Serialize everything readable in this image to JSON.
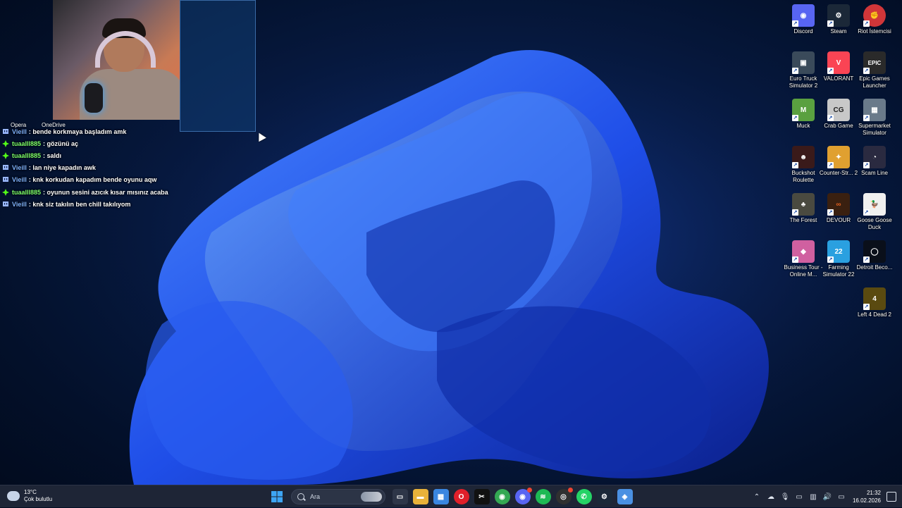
{
  "webcam": {
    "label": "webcam overlay"
  },
  "top_left_icons": [
    {
      "label": "Opera"
    },
    {
      "label": "OneDrive"
    }
  ],
  "chat": {
    "messages": [
      {
        "user": "Vieill",
        "text": ": bende korkmaya başladım amk",
        "user_color": "#7fb3ff",
        "icon": "twitch-badge-icon"
      },
      {
        "user": "tuaalll885",
        "text": ": gözünü aç",
        "user_color": "#7dff6a",
        "icon": "kick-badge-icon"
      },
      {
        "user": "tuaalll885",
        "text": ": saldı",
        "user_color": "#7dff6a",
        "icon": "kick-badge-icon"
      },
      {
        "user": "Vieill",
        "text": ": lan niye kapadın awk",
        "user_color": "#7fb3ff",
        "icon": "twitch-badge-icon"
      },
      {
        "user": "Vieill",
        "text": ": knk korkudan kapadım bende oyunu aqw",
        "user_color": "#7fb3ff",
        "icon": "twitch-badge-icon"
      },
      {
        "user": "tuaalll885",
        "text": ": oyunun sesini azıcık kısar mısınız acaba",
        "user_color": "#7dff6a",
        "icon": "kick-badge-icon"
      },
      {
        "user": "Vieill",
        "text": ": knk siz takılın ben chill takılıyom",
        "user_color": "#7fb3ff",
        "icon": "twitch-badge-icon"
      }
    ]
  },
  "desktop_icons": [
    {
      "label": "Discord",
      "icon": "discord-icon",
      "color": "#5865f2",
      "glyph": "◉"
    },
    {
      "label": "Steam",
      "icon": "steam-icon",
      "color": "#1b2838",
      "glyph": "⚙"
    },
    {
      "label": "Riot İstemcisi",
      "icon": "riot-icon",
      "color": "#d13639",
      "glyph": "✊"
    },
    {
      "label": "Euro Truck Simulator 2",
      "icon": "euro-truck-icon",
      "color": "#3a4a5a",
      "glyph": "▣"
    },
    {
      "label": "VALORANT",
      "icon": "valorant-icon",
      "color": "#fa4454",
      "glyph": "V"
    },
    {
      "label": "Epic Games Launcher",
      "icon": "epic-games-icon",
      "color": "#2a2a2a",
      "glyph": "EPIC"
    },
    {
      "label": "Muck",
      "icon": "muck-icon",
      "color": "#5aa040",
      "glyph": "M"
    },
    {
      "label": "Crab Game",
      "icon": "crab-game-icon",
      "color": "#c8c8c8",
      "glyph": "CG"
    },
    {
      "label": "Supermarket Simulator",
      "icon": "supermarket-icon",
      "color": "#6a7a8a",
      "glyph": "▦"
    },
    {
      "label": "Buckshot Roulette",
      "icon": "buckshot-icon",
      "color": "#3a1a1a",
      "glyph": "☻"
    },
    {
      "label": "Counter-Str... 2",
      "icon": "counter-strike-icon",
      "color": "#e0a030",
      "glyph": "✦"
    },
    {
      "label": "Scam Line",
      "icon": "scam-line-icon",
      "color": "#2a2a40",
      "glyph": "◔"
    },
    {
      "label": "The Forest",
      "icon": "the-forest-icon",
      "color": "#4a4a40",
      "glyph": "♣"
    },
    {
      "label": "DEVOUR",
      "icon": "devour-icon",
      "color": "#3a2010",
      "glyph": "∞"
    },
    {
      "label": "Goose Goose Duck",
      "icon": "goose-goose-duck-icon",
      "color": "#f0f0f0",
      "glyph": "🦆"
    },
    {
      "label": "Business Tour - Online M...",
      "icon": "business-tour-icon",
      "color": "#d060a0",
      "glyph": "◆"
    },
    {
      "label": "Farming Simulator 22",
      "icon": "farming-simulator-icon",
      "color": "#2aa0e0",
      "glyph": "22"
    },
    {
      "label": "Detroit Beco...",
      "icon": "detroit-icon",
      "color": "#0a0f1a",
      "glyph": "◯"
    },
    {
      "label": "Left 4 Dead 2",
      "icon": "left4dead-icon",
      "color": "#5a4a10",
      "glyph": "4"
    }
  ],
  "taskbar": {
    "weather": {
      "temp": "13°C",
      "condition": "Çok bulutlu"
    },
    "search_placeholder": "Ara",
    "apps": [
      {
        "icon": "task-view-icon",
        "color": "#2e3648",
        "glyph": "▭"
      },
      {
        "icon": "file-explorer-icon",
        "color": "#e8b23a",
        "glyph": "▬"
      },
      {
        "icon": "microsoft-store-icon",
        "color": "#3a86e0",
        "glyph": "▦"
      },
      {
        "icon": "opera-icon",
        "color": "#e0202a",
        "glyph": "O"
      },
      {
        "icon": "capcut-icon",
        "color": "#111111",
        "glyph": "✂"
      },
      {
        "icon": "chrome-icon",
        "color": "#34a853",
        "glyph": "◉"
      },
      {
        "icon": "discord-icon",
        "color": "#5865f2",
        "glyph": "◉"
      },
      {
        "icon": "spotify-icon",
        "color": "#1db954",
        "glyph": "≋"
      },
      {
        "icon": "obs-icon",
        "color": "#303030",
        "glyph": "◎"
      },
      {
        "icon": "whatsapp-icon",
        "color": "#25d366",
        "glyph": "✆"
      },
      {
        "icon": "steam-icon",
        "color": "#1b2838",
        "glyph": "⚙"
      },
      {
        "icon": "app-icon",
        "color": "#4a90e2",
        "glyph": "◈"
      }
    ],
    "tray": [
      {
        "icon": "chevron-up-icon",
        "glyph": "⌃"
      },
      {
        "icon": "onedrive-icon",
        "glyph": "☁"
      },
      {
        "icon": "microphone-icon",
        "glyph": "🎙"
      },
      {
        "icon": "display-icon",
        "glyph": "▭"
      },
      {
        "icon": "network-icon",
        "glyph": "▥"
      },
      {
        "icon": "volume-icon",
        "glyph": "🔊"
      },
      {
        "icon": "battery-icon",
        "glyph": "▭"
      }
    ],
    "time": "21:32",
    "date": "16.02.2026"
  }
}
